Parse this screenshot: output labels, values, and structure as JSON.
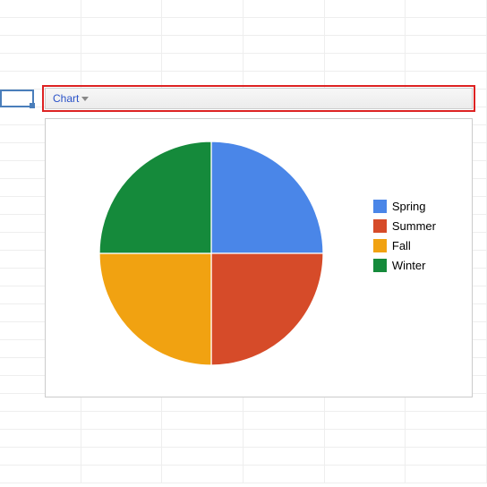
{
  "header": {
    "menu_label": "Chart"
  },
  "chart_data": {
    "type": "pie",
    "title": "",
    "series": [
      {
        "name": "Spring",
        "value": 25,
        "color": "#4a86e8"
      },
      {
        "name": "Summer",
        "value": 25,
        "color": "#d64b29"
      },
      {
        "name": "Fall",
        "value": 25,
        "color": "#f1a211"
      },
      {
        "name": "Winter",
        "value": 25,
        "color": "#158a3b"
      }
    ]
  }
}
